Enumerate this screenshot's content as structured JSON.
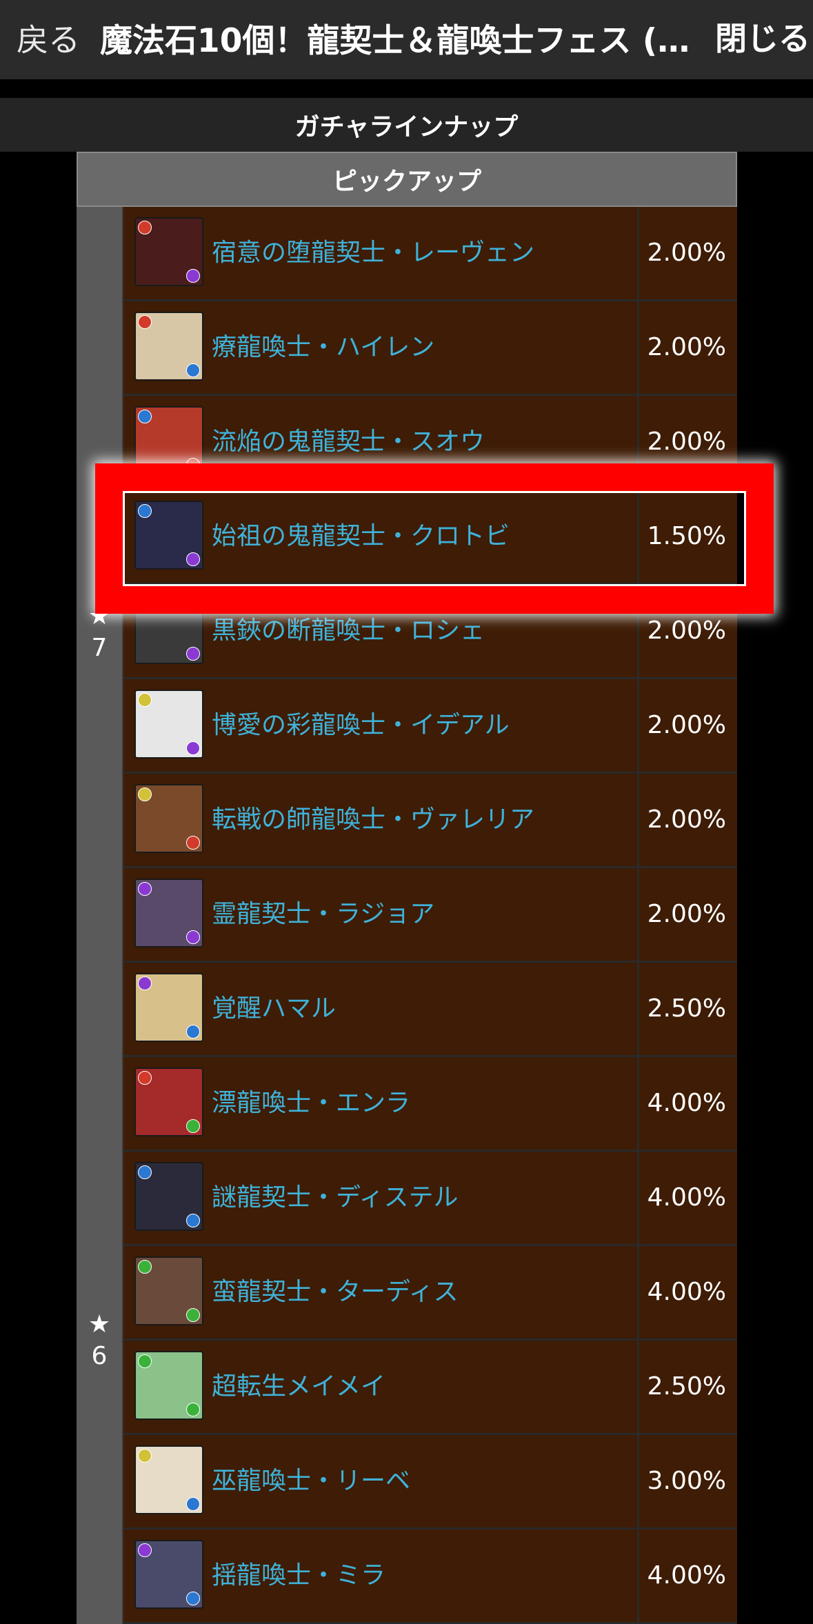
{
  "header": {
    "back_label": "戻る",
    "title": "魔法石10個！龍契士＆龍喚士フェス (…",
    "close_label": "閉じる"
  },
  "section_title": "ガチャラインナップ",
  "pickup_label": "ピックアップ",
  "groups": [
    {
      "star": "7",
      "rows": [
        {
          "name": "宿意の堕龍契士・レーヴェン",
          "rate": "2.00%",
          "bg": "#4a1c1c",
          "orb_tl": "#d23a2a",
          "orb_br": "#8a3ad2"
        },
        {
          "name": "療龍喚士・ハイレン",
          "rate": "2.00%",
          "bg": "#d8c7a6",
          "orb_tl": "#d23a2a",
          "orb_br": "#2a78d2"
        },
        {
          "name": "流焔の鬼龍契士・スオウ",
          "rate": "2.00%",
          "bg": "#b53a2a",
          "orb_tl": "#2a78d2",
          "orb_br": "#d23a2a"
        },
        {
          "name": "始祖の鬼龍契士・クロトビ",
          "rate": "1.50%",
          "bg": "#2a2a4a",
          "orb_tl": "#2a78d2",
          "orb_br": "#8a3ad2"
        },
        {
          "name": "黒鋏の断龍喚士・ロシェ",
          "rate": "2.00%",
          "bg": "#3a3a3a",
          "orb_tl": "#3ab23a",
          "orb_br": "#8a3ad2"
        },
        {
          "name": "博愛の彩龍喚士・イデアル",
          "rate": "2.00%",
          "bg": "#e6e6e6",
          "orb_tl": "#d2c23a",
          "orb_br": "#8a3ad2"
        },
        {
          "name": "転戦の師龍喚士・ヴァレリア",
          "rate": "2.00%",
          "bg": "#7a4a2a",
          "orb_tl": "#d2c23a",
          "orb_br": "#d23a2a"
        },
        {
          "name": "霊龍契士・ラジョア",
          "rate": "2.00%",
          "bg": "#5a4a6a",
          "orb_tl": "#8a3ad2",
          "orb_br": "#8a3ad2"
        },
        {
          "name": "覚醒ハマル",
          "rate": "2.50%",
          "bg": "#d8c08a",
          "orb_tl": "#8a3ad2",
          "orb_br": "#2a78d2"
        }
      ]
    },
    {
      "star": "6",
      "rows": [
        {
          "name": "漂龍喚士・エンラ",
          "rate": "4.00%",
          "bg": "#a52a2a",
          "orb_tl": "#d23a2a",
          "orb_br": "#3ab23a"
        },
        {
          "name": "謎龍契士・ディステル",
          "rate": "4.00%",
          "bg": "#2a2a3a",
          "orb_tl": "#2a78d2",
          "orb_br": "#2a78d2"
        },
        {
          "name": "蛮龍契士・ターディス",
          "rate": "4.00%",
          "bg": "#6a4a3a",
          "orb_tl": "#3ab23a",
          "orb_br": "#3ab23a"
        },
        {
          "name": "超転生メイメイ",
          "rate": "2.50%",
          "bg": "#8ac28a",
          "orb_tl": "#3ab23a",
          "orb_br": "#3ab23a"
        },
        {
          "name": "巫龍喚士・リーベ",
          "rate": "3.00%",
          "bg": "#e6dcc8",
          "orb_tl": "#d2c23a",
          "orb_br": "#2a78d2"
        },
        {
          "name": "揺龍喚士・ミラ",
          "rate": "4.00%",
          "bg": "#4a4a6a",
          "orb_tl": "#8a3ad2",
          "orb_br": "#2a78d2"
        }
      ]
    }
  ],
  "star_symbol": "★"
}
